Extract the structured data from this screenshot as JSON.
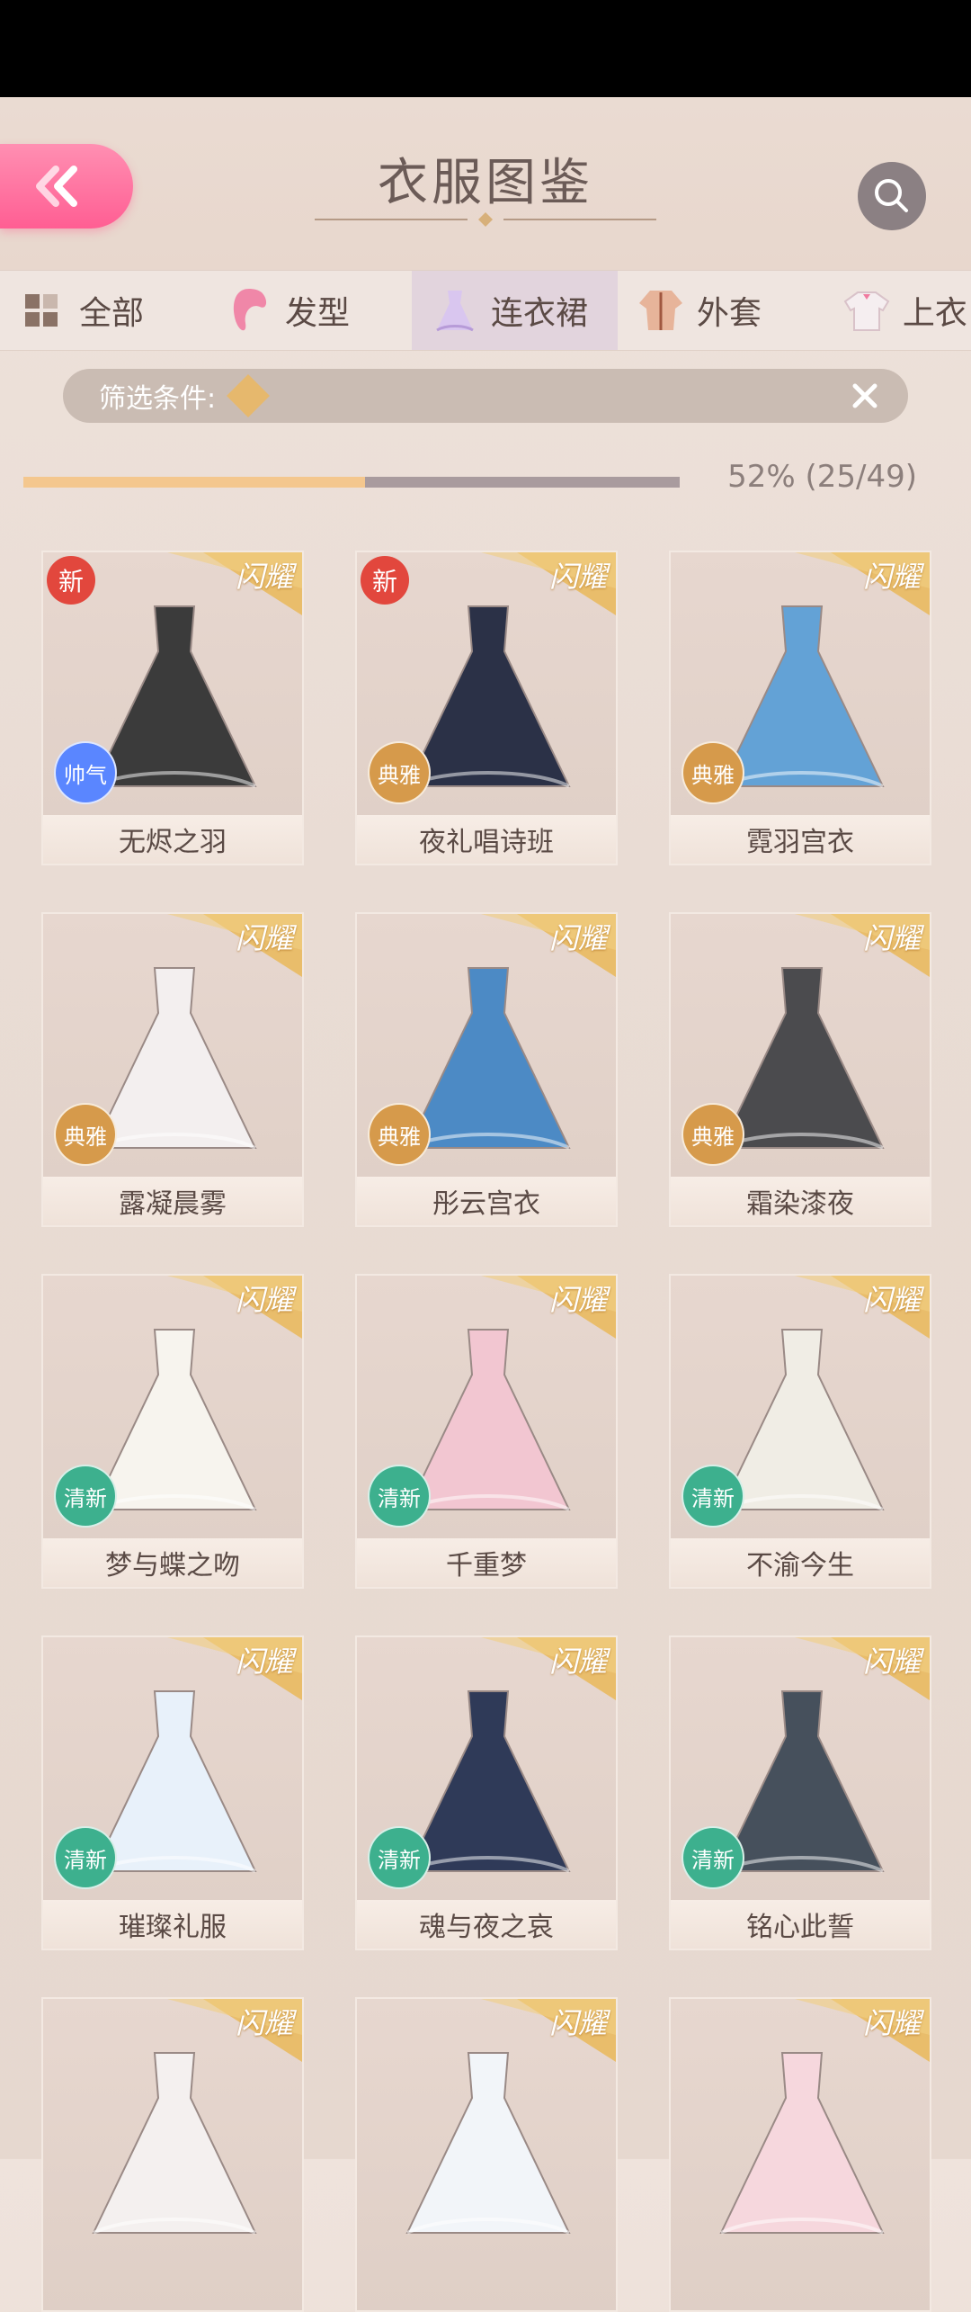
{
  "header": {
    "title": "衣服图鉴"
  },
  "tabs": [
    {
      "label": "全部",
      "icon": "grid-icon"
    },
    {
      "label": "发型",
      "icon": "hair-icon"
    },
    {
      "label": "连衣裙",
      "icon": "dress-icon"
    },
    {
      "label": "外套",
      "icon": "coat-icon"
    },
    {
      "label": "上衣",
      "icon": "top-icon"
    }
  ],
  "filter": {
    "label": "筛选条件:",
    "tag": "闪耀"
  },
  "progress": {
    "percent": 52,
    "text": "52% (25/49)"
  },
  "ribbon_text": "闪耀",
  "items": [
    {
      "name": "无烬之羽",
      "style": "帅气",
      "new": "新",
      "color": "#3b3b3b",
      "badge_color": "#5a86ff"
    },
    {
      "name": "夜礼唱诗班",
      "style": "典雅",
      "new": "新",
      "color": "#2b3147",
      "badge_color": "#d69a4b"
    },
    {
      "name": "霓羽宫衣",
      "style": "典雅",
      "new": "",
      "color": "#63a2d6",
      "badge_color": "#d69a4b"
    },
    {
      "name": "露凝晨雾",
      "style": "典雅",
      "new": "",
      "color": "#f3efef",
      "badge_color": "#d69a4b"
    },
    {
      "name": "彤云宫衣",
      "style": "典雅",
      "new": "",
      "color": "#4c8ac5",
      "badge_color": "#d69a4b"
    },
    {
      "name": "霜染漆夜",
      "style": "典雅",
      "new": "",
      "color": "#4b4b4e",
      "badge_color": "#d69a4b"
    },
    {
      "name": "梦与蝶之吻",
      "style": "清新",
      "new": "",
      "color": "#f7f4ee",
      "badge_color": "#3db08e"
    },
    {
      "name": "千重梦",
      "style": "清新",
      "new": "",
      "color": "#f2c6d1",
      "badge_color": "#3db08e"
    },
    {
      "name": "不渝今生",
      "style": "清新",
      "new": "",
      "color": "#f0ede5",
      "badge_color": "#3db08e"
    },
    {
      "name": "璀璨礼服",
      "style": "清新",
      "new": "",
      "color": "#e8f1fa",
      "badge_color": "#3db08e"
    },
    {
      "name": "魂与夜之哀",
      "style": "清新",
      "new": "",
      "color": "#2f3a58",
      "badge_color": "#3db08e"
    },
    {
      "name": "铭心此誓",
      "style": "清新",
      "new": "",
      "color": "#46505c",
      "badge_color": "#3db08e"
    },
    {
      "name": "",
      "style": "",
      "new": "",
      "color": "#f4f0ef",
      "badge_color": ""
    },
    {
      "name": "",
      "style": "",
      "new": "",
      "color": "#f2f5f9",
      "badge_color": ""
    },
    {
      "name": "",
      "style": "",
      "new": "",
      "color": "#f6d7dd",
      "badge_color": ""
    }
  ]
}
